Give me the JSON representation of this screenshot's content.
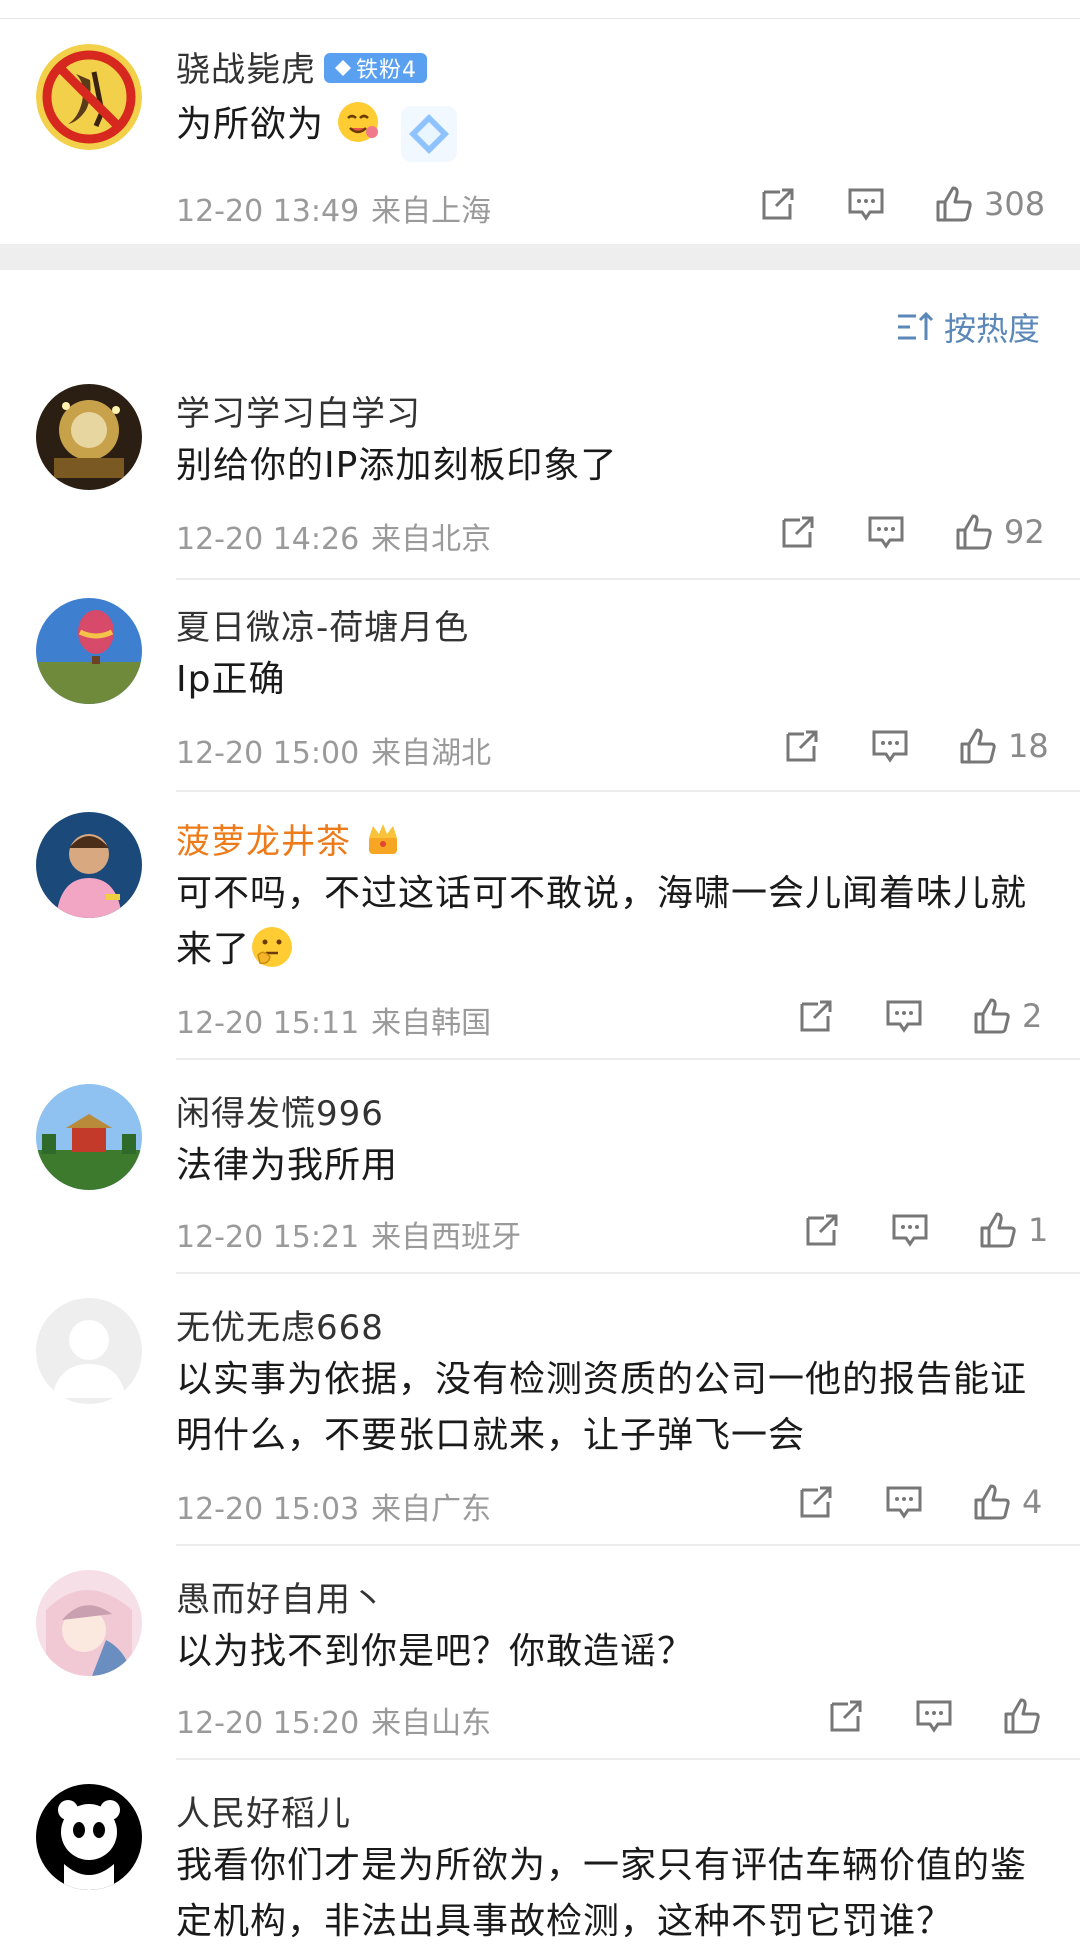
{
  "post": {
    "user": "骁战毙虎",
    "badge": "铁粉4",
    "text": "为所欲为",
    "time": "12-20 13:49",
    "location": "来自上海",
    "likes": "308"
  },
  "sort": {
    "label": "按热度"
  },
  "comments": [
    {
      "user": "学习学习白学习",
      "text": "别给你的IP添加刻板印象了",
      "time": "12-20 14:26",
      "location": "来自北京",
      "likes": "92"
    },
    {
      "user": "夏日微凉-荷塘月色",
      "text": "Ip正确",
      "time": "12-20 15:00",
      "location": "来自湖北",
      "likes": "18"
    },
    {
      "user": "菠萝龙井茶",
      "text_line1": "可不吗，不过这话可不敢说，海啸一会儿闻着味儿就",
      "text_line2": "来了",
      "time": "12-20 15:11",
      "location": "来自韩国",
      "likes": "2"
    },
    {
      "user": "闲得发慌996",
      "text": "法律为我所用",
      "time": "12-20 15:21",
      "location": "来自西班牙",
      "likes": "1"
    },
    {
      "user": "无优无虑668",
      "text_line1": "以实事为依据，没有检测资质的公司一他的报告能证",
      "text_line2": "明什么，不要张口就来，让子弹飞一会",
      "time": "12-20 15:03",
      "location": "来自广东",
      "likes": "4"
    },
    {
      "user": "愚而好自用丶",
      "text": "以为找不到你是吧？你敢造谣？",
      "time": "12-20 15:20",
      "location": "来自山东",
      "likes": ""
    },
    {
      "user": "人民好稻儿",
      "text_line1": "我看你们才是为所欲为，一家只有评估车辆价值的鉴",
      "text_line2": "定机构，非法出具事故检测，这种不罚它罚谁？"
    }
  ],
  "colors": {
    "accent_blue": "#5b87b9",
    "vip_orange": "#ee7b1a",
    "meta_gray": "#9a9a9a"
  }
}
